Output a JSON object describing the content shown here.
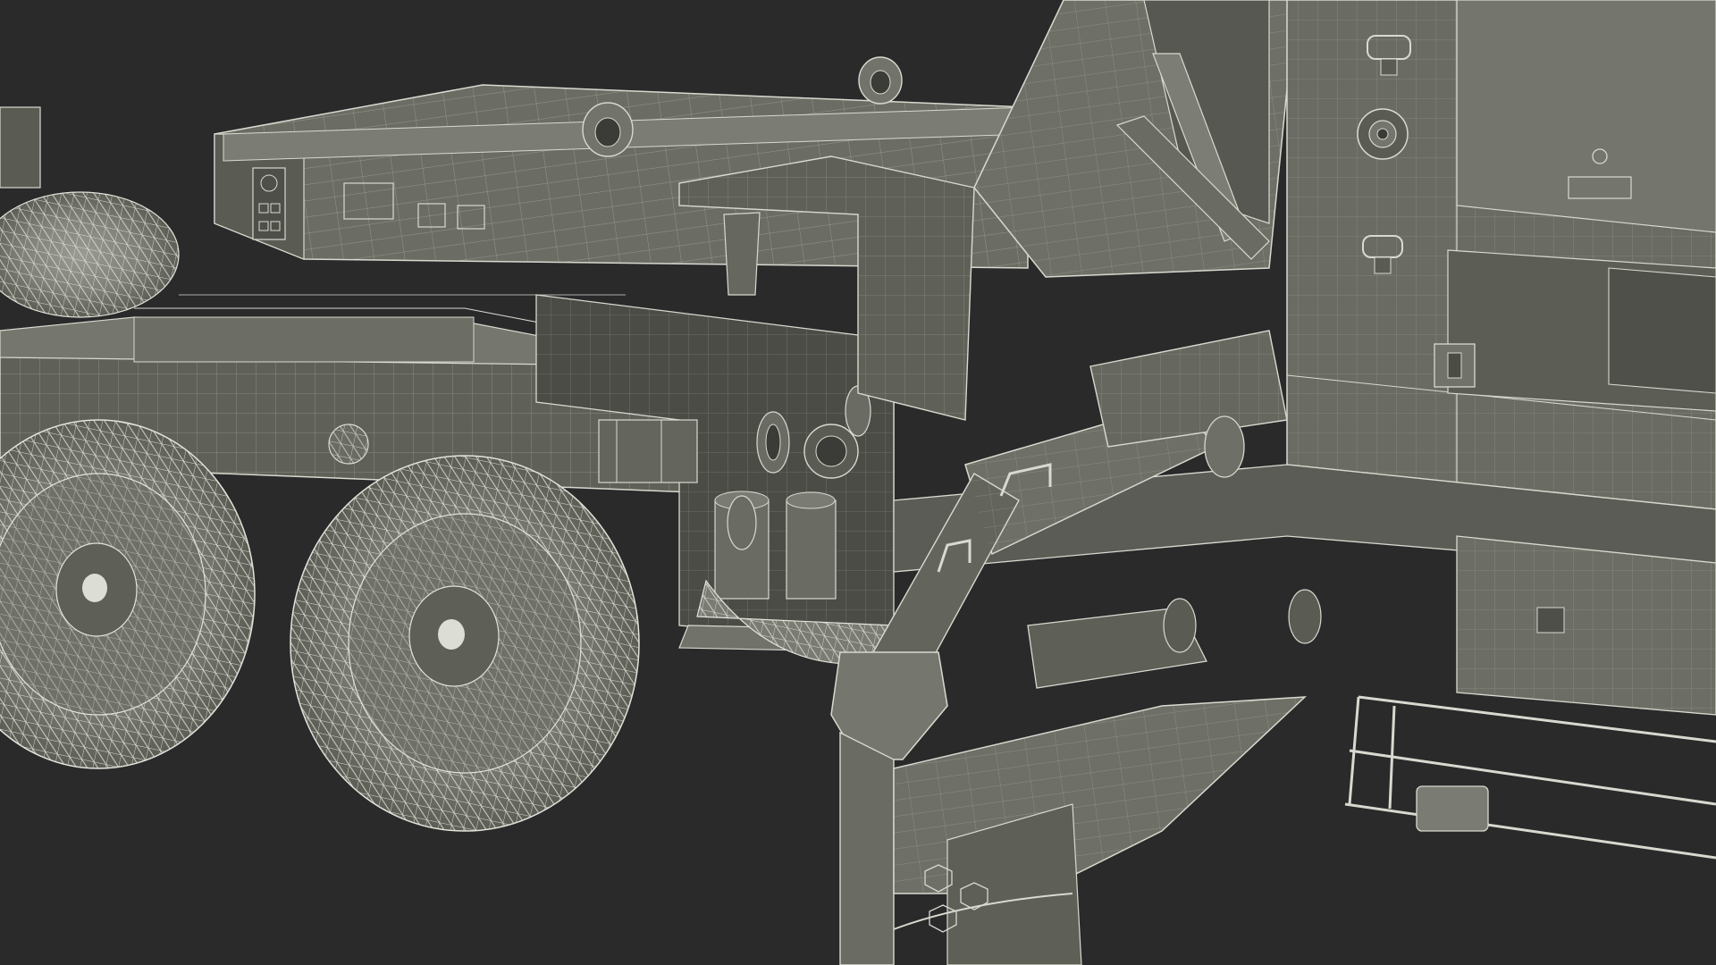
{
  "scene": {
    "subject": "wireframe-render",
    "colors": {
      "background": "#2a2a2b",
      "body": "#6e6f66",
      "body_dark": "#55564f",
      "body_light": "#85867d",
      "shadow": "#3d3e39",
      "wire": "#d8d9cf",
      "wire_dense": "#e6e7de",
      "tire": "#7a7b72"
    }
  }
}
